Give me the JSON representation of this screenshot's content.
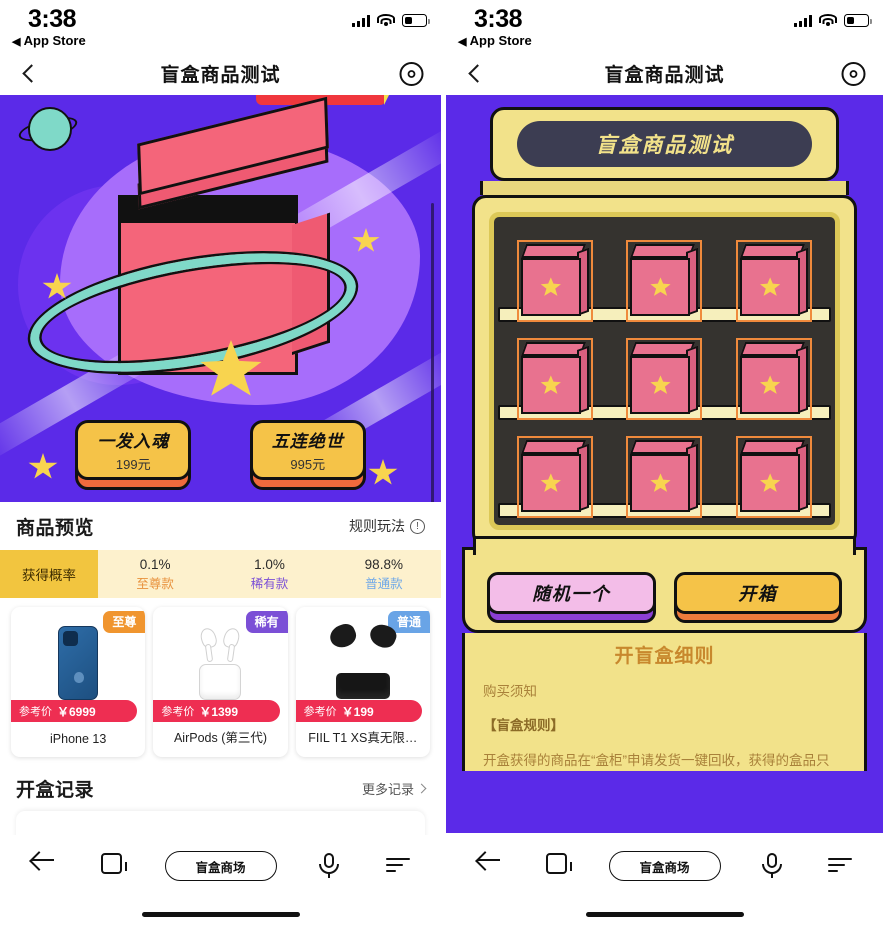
{
  "status_bar": {
    "time": "3:38",
    "back_label": "App Store",
    "back_triangle": "◀",
    "signal_icon": "cellular-signal-icon",
    "wifi_icon": "wifi-icon",
    "battery_icon": "battery-icon"
  },
  "nav_bar": {
    "back_icon": "chevron-left-icon",
    "title": "盲盒商品测试",
    "action_icon": "compass-icon"
  },
  "left_screen": {
    "hero": {
      "illustration": "blind-box-illustration",
      "background_color": "#5b2ae8",
      "box_color": "#f4657a",
      "ring_color": "#7fd9c8",
      "offers": [
        {
          "title": "一发入魂",
          "price": "199元"
        },
        {
          "title": "五连绝世",
          "price": "995元"
        }
      ]
    },
    "preview": {
      "title": "商品预览",
      "rule_label": "规则玩法",
      "rule_icon": "info-icon"
    },
    "probability": {
      "label": "获得概率",
      "items": [
        {
          "pct": "0.1%",
          "name": "至尊款",
          "color": "#e8913c"
        },
        {
          "pct": "1.0%",
          "name": "稀有款",
          "color": "#7b4fd6"
        },
        {
          "pct": "98.8%",
          "name": "普通款",
          "color": "#6fa8e8"
        }
      ]
    },
    "products": [
      {
        "badge": "至尊",
        "badge_color": "#f0952f",
        "price_label": "参考价",
        "price": "￥6999",
        "name": "iPhone 13",
        "image": "iphone-13-image"
      },
      {
        "badge": "稀有",
        "badge_color": "#7b4fd6",
        "price_label": "参考价",
        "price": "￥1399",
        "name": "AirPods (第三代)",
        "image": "airpods-image"
      },
      {
        "badge": "普通",
        "badge_color": "#69a4e6",
        "price_label": "参考价",
        "price": "￥199",
        "name": "FIIL T1 XS真无限…",
        "image": "fiil-earbuds-image"
      }
    ],
    "records": {
      "title": "开盒记录",
      "more_label": "更多记录",
      "more_icon": "chevron-right-icon"
    }
  },
  "right_screen": {
    "machine": {
      "sign_text": "盲盒商品测试",
      "body_color": "#f2e28a",
      "window_color": "#35332f",
      "box_color": "#e8728f",
      "shelf_rows": 3,
      "boxes_per_row": 3,
      "box_icon": "star-box-icon"
    },
    "buttons": [
      {
        "label": "随机一个",
        "face_color": "#f3bde8",
        "shadow_color": "#8b3fd4"
      },
      {
        "label": "开箱",
        "face_color": "#f5c348",
        "shadow_color": "#ee7b3c"
      }
    ],
    "rules": {
      "title": "开盲盒细则",
      "lines": [
        "购买须知",
        "【盲盒规则】",
        "开盒获得的商品在“盒柜”申请发货一键回收，获得的盒品只"
      ]
    }
  },
  "bottom_bar": {
    "back_icon": "arrow-left-icon",
    "snapshot_icon": "screenshot-icon",
    "pill_label": "盲盒商场",
    "mic_icon": "microphone-icon",
    "menu_icon": "menu-icon",
    "home_indicator": "home-indicator"
  }
}
